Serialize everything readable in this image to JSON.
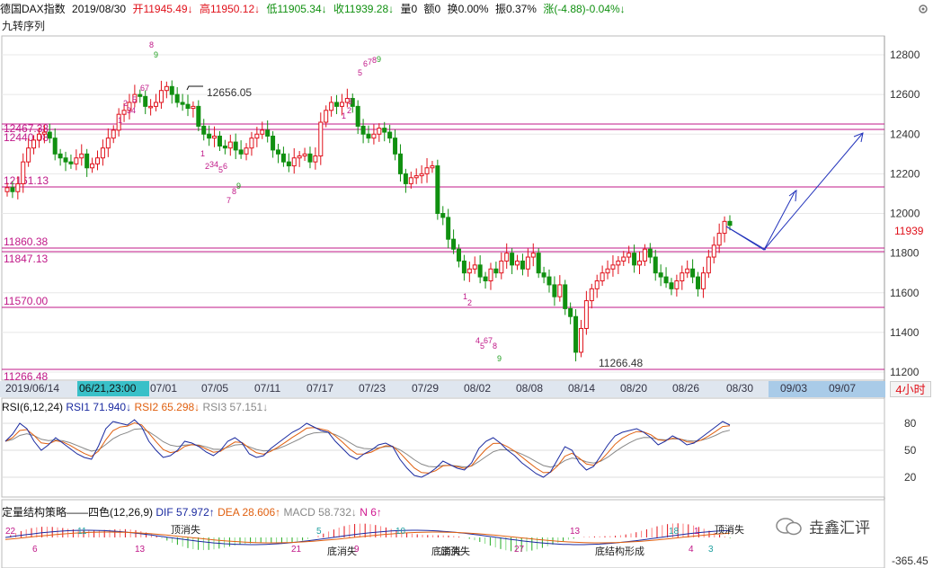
{
  "header": {
    "instrument": "德国DAX指数",
    "date": "2019/08/30",
    "open": "开11945.49↓",
    "high": "高11950.12↓",
    "low": "低11905.34↓",
    "close": "收11939.28↓",
    "volume": "量0",
    "amount": "额0",
    "turnover": "换0.00%",
    "amplitude": "振0.37%",
    "change": "涨(-4.88)-0.04%↓"
  },
  "sequence_label": "九转序列",
  "y_axis": [
    "12800",
    "12600",
    "12400",
    "12200",
    "12000",
    "11800",
    "11600",
    "11400",
    "11200"
  ],
  "last_price_tag": "11939",
  "levels": {
    "l1": "12467.38",
    "l2": "12440.98",
    "l3": "12161.13",
    "l4": "11860.38",
    "l5": "11847.13",
    "l6": "11570.00",
    "l7": "11266.48"
  },
  "annotations": {
    "peak": "12656.05",
    "trough": "11266.48"
  },
  "x_axis": {
    "first": "2019/06/14",
    "highlight": "06/21,23:00",
    "ticks": [
      "07/01",
      "07/05",
      "07/11",
      "07/17",
      "07/23",
      "07/29",
      "08/02",
      "08/08",
      "08/14",
      "08/20",
      "08/26",
      "08/30",
      "09/03",
      "09/07"
    ],
    "period": "4小时"
  },
  "rsi": {
    "title": "RSI(6,12,24)",
    "rsi1": "RSI1 71.940↓",
    "rsi2": "RSI2 65.298↓",
    "rsi3": "RSI3 57.151↓",
    "levels": [
      "80",
      "50",
      "20"
    ]
  },
  "macd": {
    "title": "定量结构策略——四色(12,26,9)",
    "dif": "DIF 57.972↑",
    "dea": "DEA 28.606↑",
    "macd": "MACD 58.732↓",
    "n": "N 6↑",
    "bottom_value": "-365.45",
    "labels": [
      "底消失",
      "底消失",
      "底消失",
      "底结构形成",
      "顶消失",
      "顶消失"
    ],
    "numbers": [
      "22",
      "11",
      "6",
      "13",
      "5",
      "21",
      "9",
      "10",
      "27",
      "13",
      "18",
      "1",
      "4",
      "3"
    ]
  },
  "watermark": "垚鑫汇评",
  "colors": {
    "up": "#e0101a",
    "down": "#109010",
    "level": "#c01888",
    "rsi1": "#1a2aa0",
    "rsi2": "#e06010",
    "rsi3": "#888888",
    "arrow": "#2233bb"
  }
}
